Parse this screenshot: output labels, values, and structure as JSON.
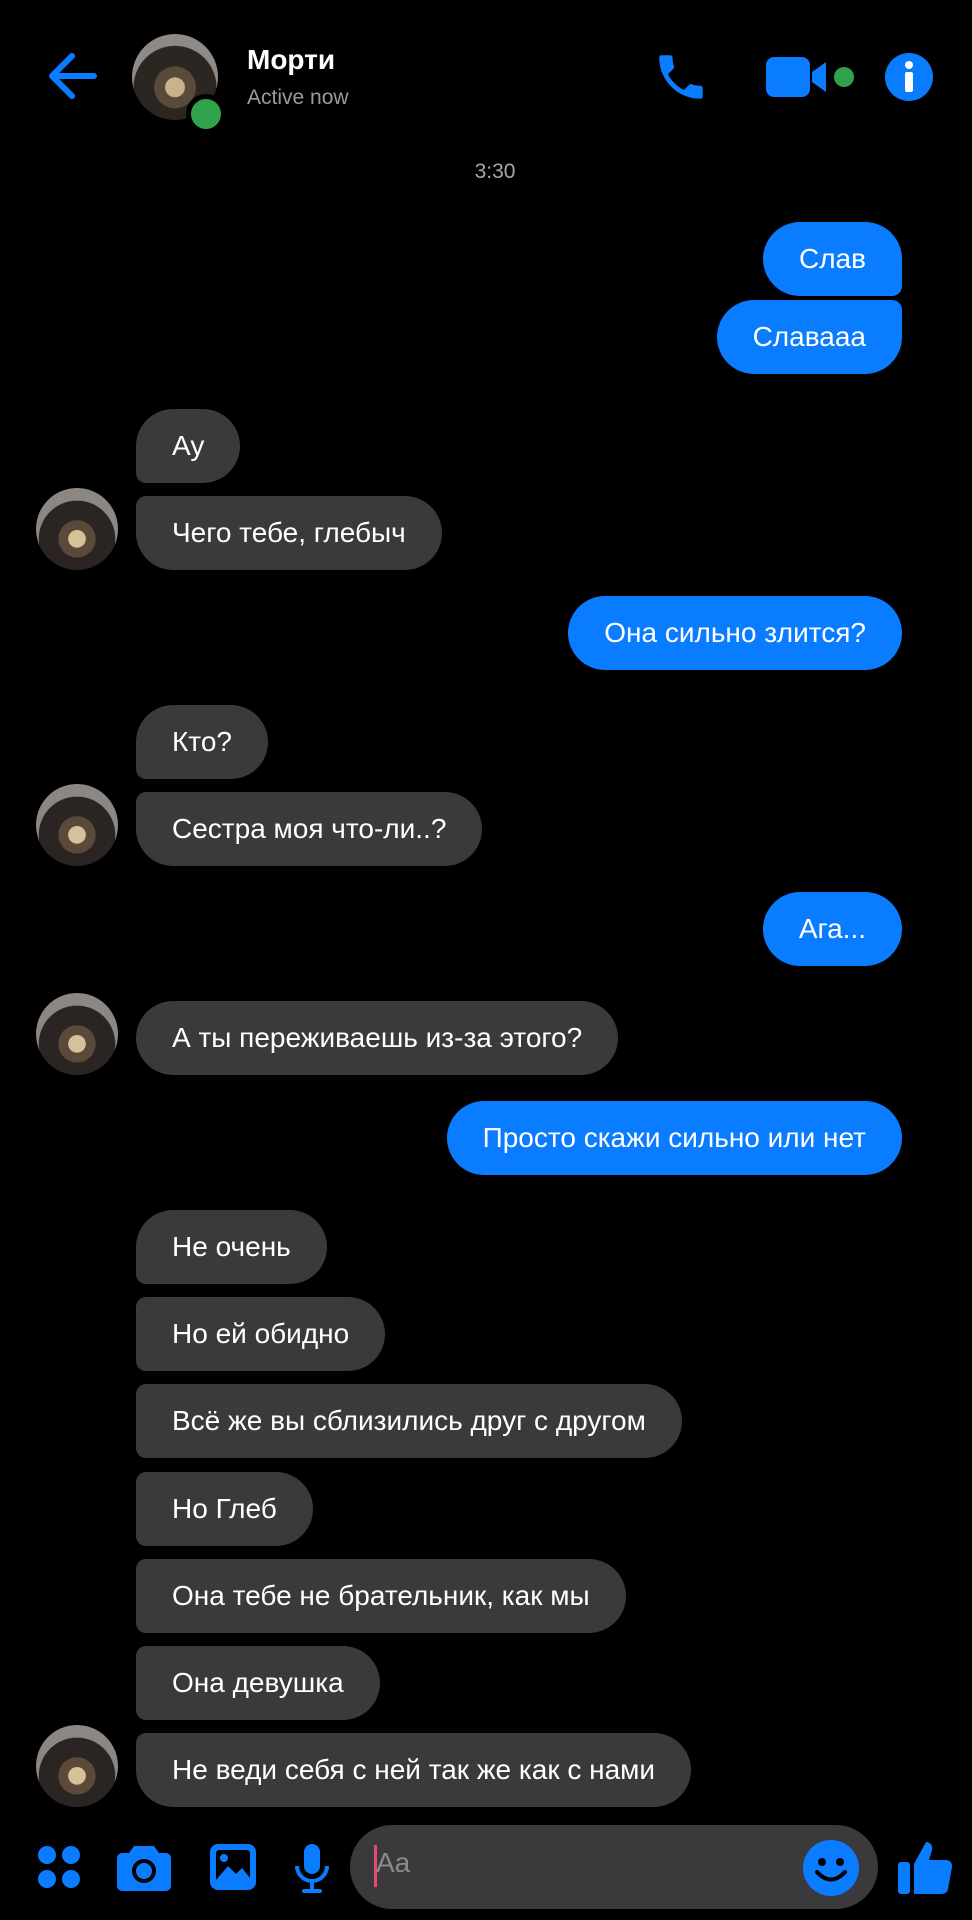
{
  "header": {
    "contact_name": "Морти",
    "status": "Active now",
    "icons": [
      "back-arrow-icon",
      "phone-icon",
      "video-camera-icon",
      "info-icon"
    ],
    "accent_color": "#0a7cff",
    "online_color": "#31a24c"
  },
  "conversation": {
    "timestamp": "3:30",
    "messages": [
      {
        "dir": "out",
        "text": "Слав"
      },
      {
        "dir": "out",
        "text": "Славааа"
      },
      {
        "dir": "in",
        "text": "Ау"
      },
      {
        "dir": "in",
        "text": "Чего тебе,  глебыч"
      },
      {
        "dir": "out",
        "text": "Она сильно злится?"
      },
      {
        "dir": "in",
        "text": "Кто?"
      },
      {
        "dir": "in",
        "text": "Сестра моя что-ли..?"
      },
      {
        "dir": "out",
        "text": "Ага..."
      },
      {
        "dir": "in",
        "text": "А ты переживаешь из-за этого?"
      },
      {
        "dir": "out",
        "text": "Просто скажи сильно или нет"
      },
      {
        "dir": "in",
        "text": "Не очень"
      },
      {
        "dir": "in",
        "text": "Но ей обидно"
      },
      {
        "dir": "in",
        "text": "Всё же вы сблизились друг с другом"
      },
      {
        "dir": "in",
        "text": "Но Глеб"
      },
      {
        "dir": "in",
        "text": "Она тебе не брательник, как мы"
      },
      {
        "dir": "in",
        "text": "Она девушка"
      },
      {
        "dir": "in",
        "text": "Не веди себя с ней так же как с нами"
      }
    ]
  },
  "composer": {
    "placeholder": "Aa",
    "icons": [
      "menu-grid-icon",
      "camera-icon",
      "gallery-icon",
      "microphone-icon",
      "emoji-icon",
      "thumbs-up-icon"
    ]
  }
}
